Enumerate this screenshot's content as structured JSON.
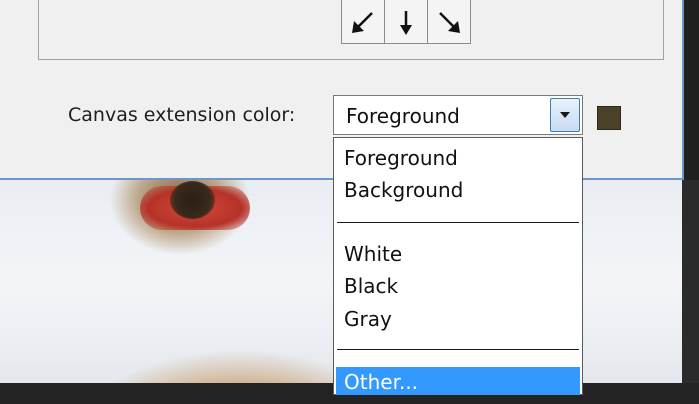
{
  "canvas_extension": {
    "label": "Canvas extension color:",
    "selected": "Foreground",
    "swatch_color": "#4b4028"
  },
  "dropdown": {
    "options": [
      "Foreground",
      "Background",
      "White",
      "Black",
      "Gray",
      "Other..."
    ],
    "highlighted": "Other...",
    "highlight_color": "#3399ff"
  },
  "anchor": {
    "visible_arrows": [
      "arrow-down-left-icon",
      "arrow-down-icon",
      "arrow-down-right-icon"
    ]
  }
}
